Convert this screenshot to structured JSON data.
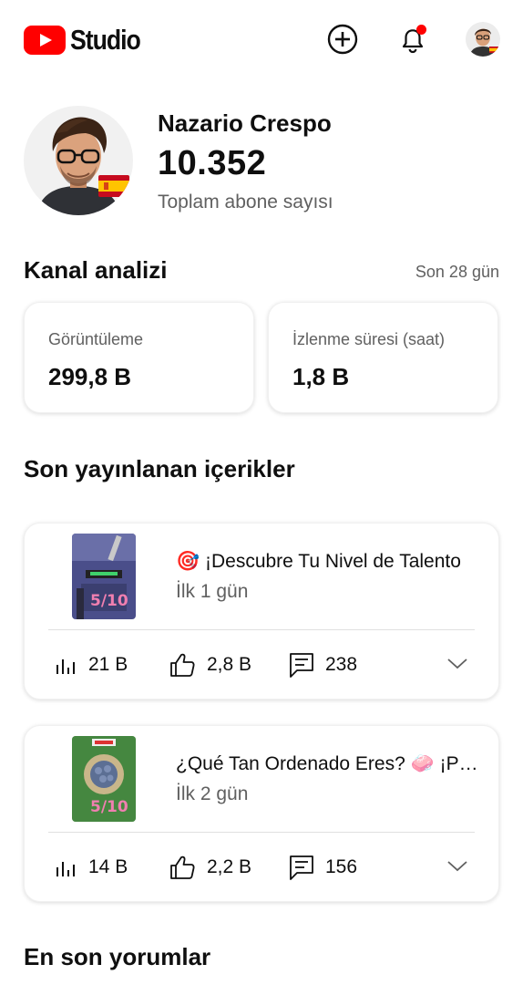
{
  "header": {
    "brand_label": "Studio",
    "icons": [
      "youtube-logo-icon",
      "create-icon",
      "notifications-icon",
      "account-avatar"
    ],
    "accent_color": "#ff0000"
  },
  "channel": {
    "name": "Nazario Crespo",
    "subscriber_count": "10.352",
    "subscriber_label": "Toplam abone sayısı"
  },
  "analytics": {
    "title": "Kanal analizi",
    "period": "Son 28 gün",
    "cards": [
      {
        "label": "Görüntüleme",
        "value": "299,8 B"
      },
      {
        "label": "İzlenme süresi (saat)",
        "value": "1,8 B"
      }
    ]
  },
  "recent_content": {
    "title": "Son yayınlanan içerikler",
    "videos": [
      {
        "title": "🎯 ¡Descubre Tu Nivel de Talento",
        "age": "İlk 1 gün",
        "views": "21 B",
        "likes": "2,8 B",
        "comments": "238"
      },
      {
        "title": "¿Qué Tan Ordenado Eres? 🧼 ¡Pon a prueba",
        "age": "İlk 2 gün",
        "views": "14 B",
        "likes": "2,2 B",
        "comments": "156"
      }
    ]
  },
  "latest_comments": {
    "title": "En son yorumlar"
  }
}
